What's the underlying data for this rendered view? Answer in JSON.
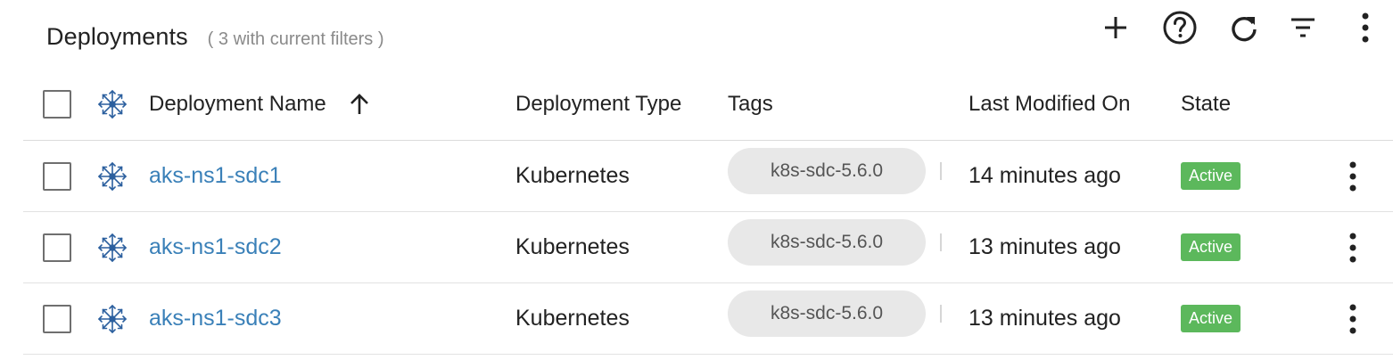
{
  "header": {
    "title": "Deployments",
    "subtitle": "( 3 with current filters )"
  },
  "toolbar": {
    "icons": [
      "add-icon",
      "help-icon",
      "refresh-icon",
      "filter-icon",
      "more-vertical-icon"
    ]
  },
  "table": {
    "columns": {
      "name": "Deployment Name",
      "type": "Deployment Type",
      "tags": "Tags",
      "modified": "Last Modified On",
      "state": "State"
    },
    "sort": {
      "column": "Deployment Name",
      "direction": "ascending",
      "icon": "arrow-up-icon"
    },
    "rows": [
      {
        "name": "aks-ns1-sdc1",
        "type": "Kubernetes",
        "tag": "k8s-sdc-5.6.0",
        "modified": "14 minutes ago",
        "state": "Active"
      },
      {
        "name": "aks-ns1-sdc2",
        "type": "Kubernetes",
        "tag": "k8s-sdc-5.6.0",
        "modified": "13 minutes ago",
        "state": "Active"
      },
      {
        "name": "aks-ns1-sdc3",
        "type": "Kubernetes",
        "tag": "k8s-sdc-5.6.0",
        "modified": "13 minutes ago",
        "state": "Active"
      }
    ]
  },
  "colors": {
    "link": "#3a80b8",
    "badge_active": "#5cb85c",
    "tag_chip": "#e8e8e8",
    "icon_blue": "#2b5f9e"
  }
}
